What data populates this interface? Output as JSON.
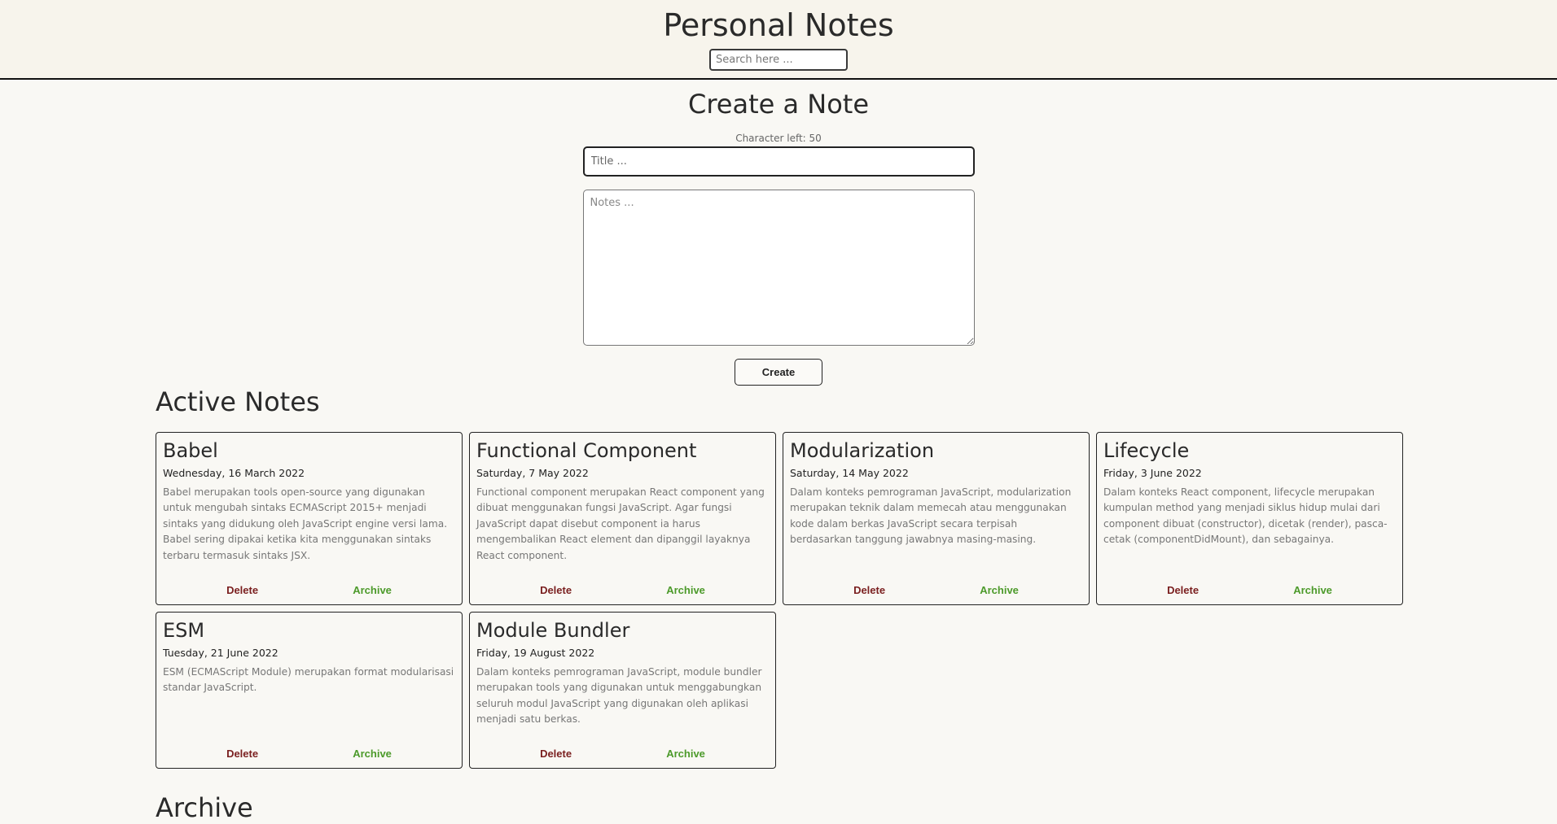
{
  "header": {
    "title": "Personal Notes",
    "search_placeholder": "Search here ..."
  },
  "create": {
    "title": "Create a Note",
    "char_left_label": "Character left: 50",
    "title_placeholder": "Title ...",
    "title_value": "",
    "notes_placeholder": "Notes ...",
    "notes_value": "",
    "create_label": "Create"
  },
  "active": {
    "heading": "Active Notes",
    "notes": [
      {
        "title": "Babel",
        "date": "Wednesday, 16 March 2022",
        "body": "Babel merupakan tools open-source yang digunakan untuk mengubah sintaks ECMAScript 2015+ menjadi sintaks yang didukung oleh JavaScript engine versi lama. Babel sering dipakai ketika kita menggunakan sintaks terbaru termasuk sintaks JSX.",
        "delete_label": "Delete",
        "archive_label": "Archive"
      },
      {
        "title": "Functional Component",
        "date": "Saturday, 7 May 2022",
        "body": "Functional component merupakan React component yang dibuat menggunakan fungsi JavaScript. Agar fungsi JavaScript dapat disebut component ia harus mengembalikan React element dan dipanggil layaknya React component.",
        "delete_label": "Delete",
        "archive_label": "Archive"
      },
      {
        "title": "Modularization",
        "date": "Saturday, 14 May 2022",
        "body": "Dalam konteks pemrograman JavaScript, modularization merupakan teknik dalam memecah atau menggunakan kode dalam berkas JavaScript secara terpisah berdasarkan tanggung jawabnya masing-masing.",
        "delete_label": "Delete",
        "archive_label": "Archive"
      },
      {
        "title": "Lifecycle",
        "date": "Friday, 3 June 2022",
        "body": "Dalam konteks React component, lifecycle merupakan kumpulan method yang menjadi siklus hidup mulai dari component dibuat (constructor), dicetak (render), pasca-cetak (componentDidMount), dan sebagainya.",
        "delete_label": "Delete",
        "archive_label": "Archive"
      },
      {
        "title": "ESM",
        "date": "Tuesday, 21 June 2022",
        "body": "ESM (ECMAScript Module) merupakan format modularisasi standar JavaScript.",
        "delete_label": "Delete",
        "archive_label": "Archive"
      },
      {
        "title": "Module Bundler",
        "date": "Friday, 19 August 2022",
        "body": "Dalam konteks pemrograman JavaScript, module bundler merupakan tools yang digunakan untuk menggabungkan seluruh modul JavaScript yang digunakan oleh aplikasi menjadi satu berkas.",
        "delete_label": "Delete",
        "archive_label": "Archive"
      }
    ]
  },
  "archive": {
    "heading": "Archive"
  },
  "colors": {
    "header_bg": "#f7f4ec",
    "page_bg": "#f9f8f4",
    "delete": "#7a1f1f",
    "archive": "#4c9a2a"
  }
}
